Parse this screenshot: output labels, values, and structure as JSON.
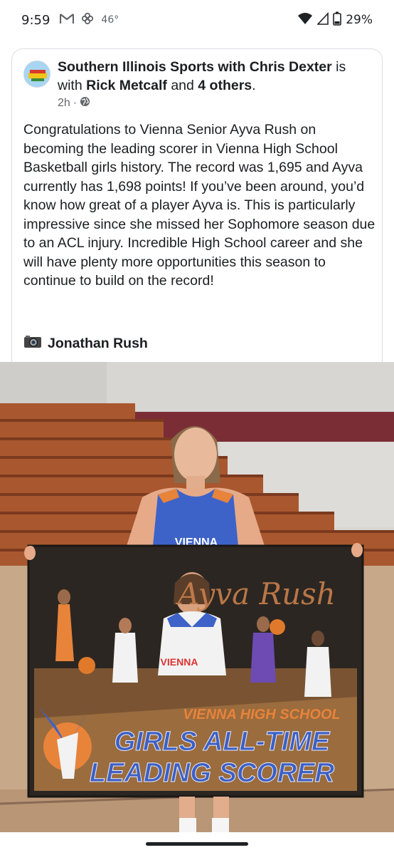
{
  "status_bar": {
    "time": "9:59",
    "temperature": "46°",
    "battery": "29%",
    "icons": [
      "gmail-icon",
      "pinwheel-icon",
      "wifi-icon",
      "signal-icon",
      "battery-icon"
    ]
  },
  "post": {
    "page_name": "Southern Illinois Sports with Chris Dexter",
    "is_with": " is with ",
    "tagged_person": "Rick Metcalf",
    "and_text": " and ",
    "others": "4 others",
    "period": ".",
    "time_ago": "2h",
    "dot": "·",
    "privacy_icon": "globe-icon",
    "body": "Congratulations to Vienna Senior Ayva Rush on becoming the leading scorer in Vienna High School Basketball girls history. The record was 1,695 and Ayva currently has 1,698 points! If you’ve been around, you’d know how great of a player Ayva is. This is particularly impressive since she missed her Sophomore season due to an ACL injury. Incredible High School career and she will have plenty more opportunities this season  to continue to build on the record!",
    "credit_icon": "camera-icon",
    "credit_name": "Jonathan Rush"
  },
  "photo": {
    "jersey_text": "VIENNA",
    "banner_signature": "Ayva Rush",
    "banner_small_jersey": "VIENNA",
    "banner_school": "VIENNA HIGH SCHOOL",
    "banner_line1": "GIRLS ALL-TIME",
    "banner_line2": "LEADING SCORER"
  },
  "colors": {
    "link_text": "#1c1e21",
    "meta": "#65676b",
    "banner_blue": "#3d5fc4",
    "banner_orange": "#e8833a"
  }
}
